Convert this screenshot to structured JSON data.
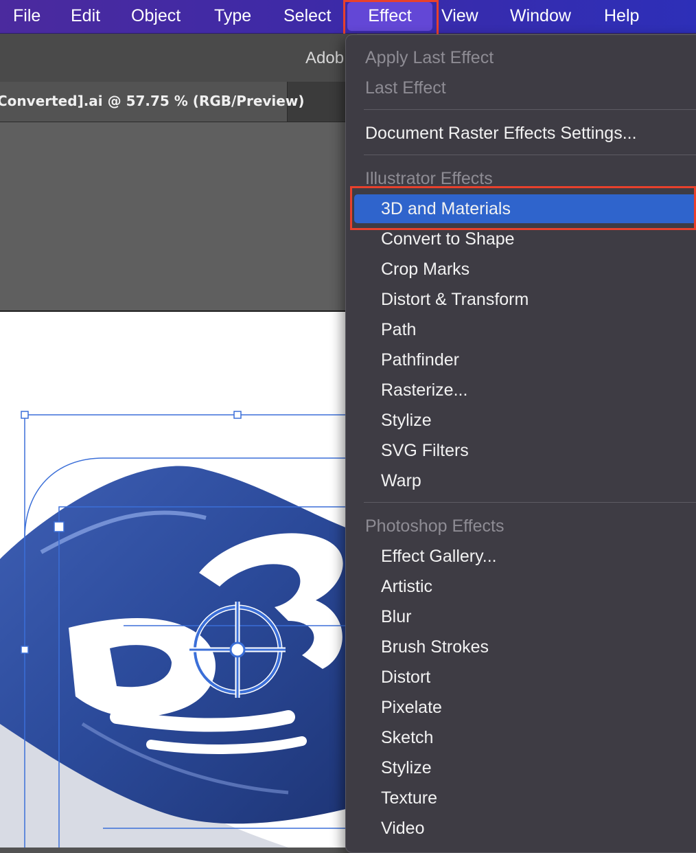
{
  "menubar": {
    "items": [
      "File",
      "Edit",
      "Object",
      "Type",
      "Select",
      "Effect",
      "View",
      "Window",
      "Help"
    ],
    "active": "Effect"
  },
  "app": {
    "title_partial": "Adob",
    "doc_tab_label": "Converted].ai @ 57.75 % (RGB/Preview)"
  },
  "effect_menu": {
    "apply_last_effect": "Apply Last Effect",
    "last_effect": "Last Effect",
    "document_raster_settings": "Document Raster Effects Settings...",
    "illustrator_effects_header": "Illustrator Effects",
    "illustrator_effects": [
      "3D and Materials",
      "Convert to Shape",
      "Crop Marks",
      "Distort & Transform",
      "Path",
      "Pathfinder",
      "Rasterize...",
      "Stylize",
      "SVG Filters",
      "Warp"
    ],
    "highlighted": "3D and Materials",
    "photoshop_effects_header": "Photoshop Effects",
    "photoshop_effects": [
      "Effect Gallery...",
      "Artistic",
      "Blur",
      "Brush Strokes",
      "Distort",
      "Pixelate",
      "Sketch",
      "Stylize",
      "Texture",
      "Video"
    ]
  },
  "colors": {
    "menubar": "#3c2aa8",
    "highlight": "#2f64cc",
    "annotation": "#e8412c",
    "artwork_blue": "#2b4a9a",
    "selection": "#3b6fd8"
  },
  "icons": {
    "center_point": "crosshair-target-icon"
  }
}
